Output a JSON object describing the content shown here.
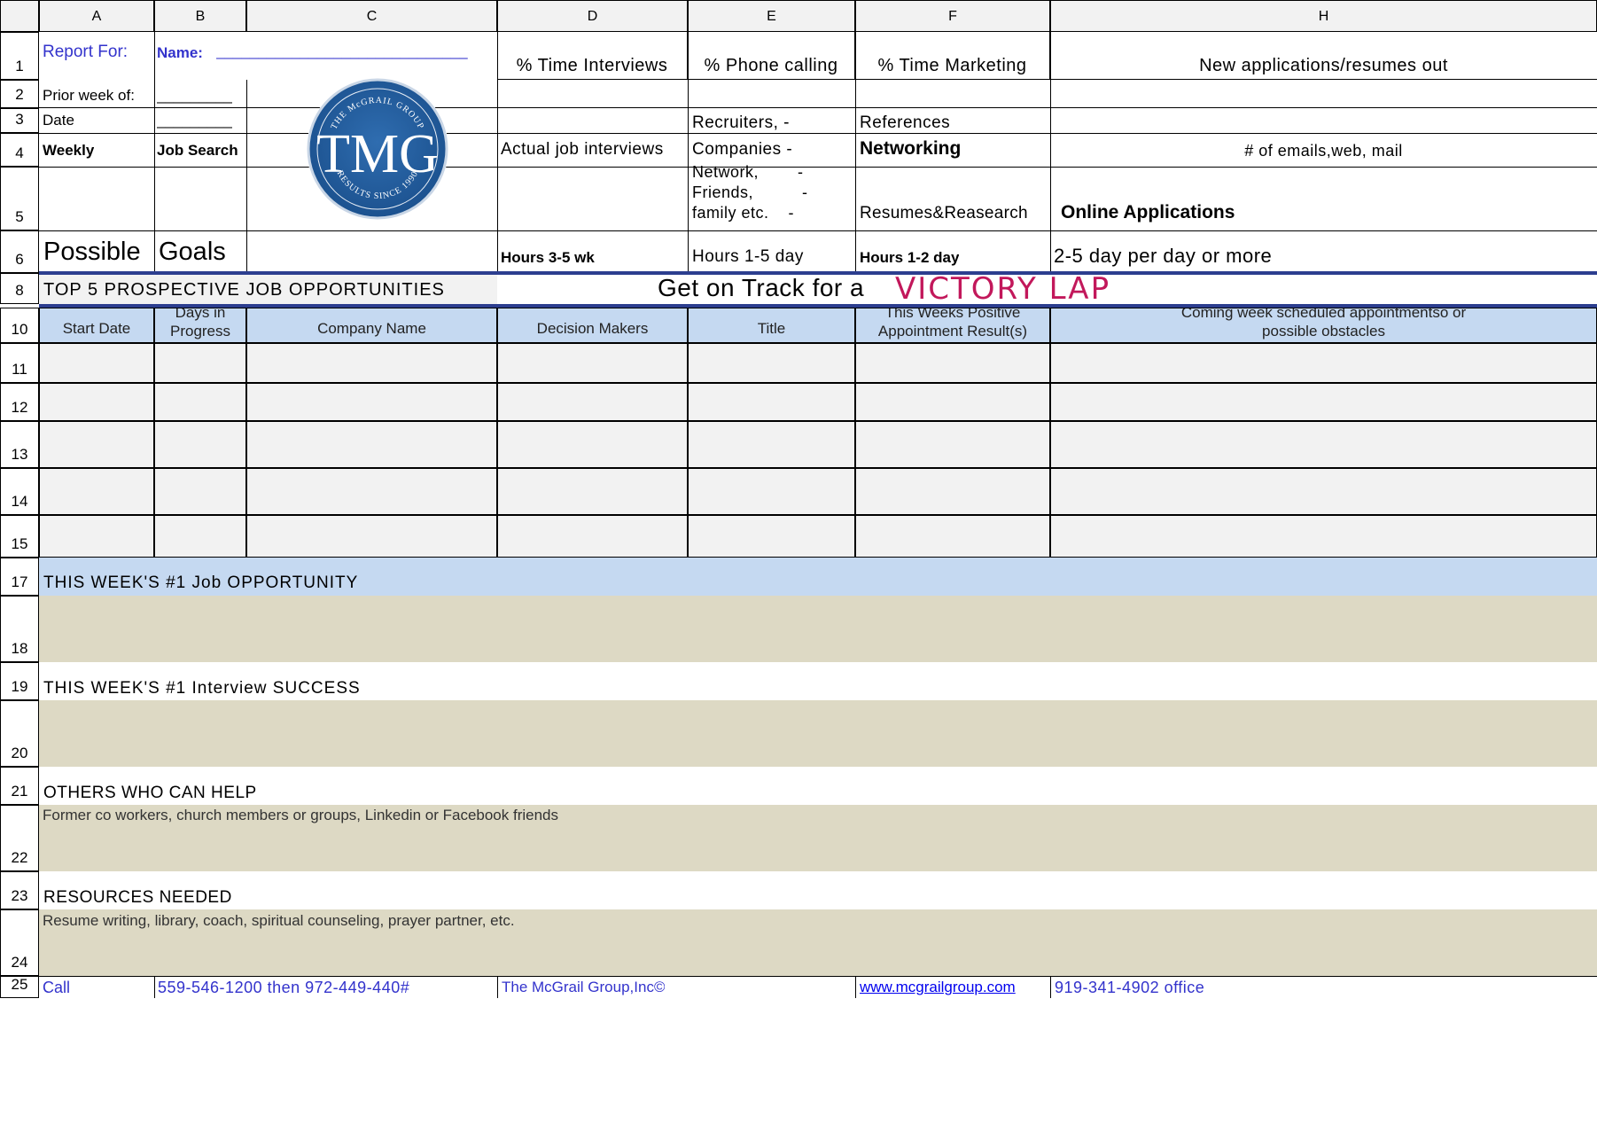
{
  "columns": [
    "A",
    "B",
    "C",
    "D",
    "E",
    "F",
    "H"
  ],
  "row_numbers": [
    "1",
    "2",
    "3",
    "4",
    "5",
    "6",
    "8",
    "10",
    "11",
    "12",
    "13",
    "14",
    "15",
    "17",
    "18",
    "19",
    "20",
    "21",
    "22",
    "23",
    "24",
    "25"
  ],
  "header": {
    "report_for": "Report For:",
    "name_label": "Name:",
    "name_line": "______________________________",
    "prior_week": "Prior week of:",
    "prior_week_blank": "_________",
    "date": "Date",
    "date_blank": "_________",
    "weekly": "Weekly",
    "job_search": "Job Search",
    "possible": "Possible",
    "goals": "Goals",
    "d1": "% Time Interviews",
    "e1": "% Phone calling",
    "f1": "% Time Marketing",
    "h1": "New applications/resumes out",
    "e3": "Recruiters, -",
    "f3": "References",
    "d4": "Actual job interviews",
    "e4": "Companies  -",
    "f4": "Networking",
    "h4": "# of emails,web, mail",
    "e5_1": "Network,        -",
    "e5_2": "Friends,          -",
    "e5_3": "family etc.    -",
    "f5": "Resumes&Reasearch",
    "h5": "Online Applications",
    "d6": "Hours  3-5 wk",
    "e6": "Hours 1-5 day",
    "f6": "Hours 1-2  day",
    "h6": "2-5 day per day or more"
  },
  "logo": {
    "text": "TMG",
    "top_arc": "THE McGRAIL GROUP",
    "bottom_arc": "RESULTS SINCE 1990"
  },
  "section8": {
    "title": "TOP 5 PROSPECTIVE JOB OPPORTUNITIES",
    "track": "Get on Track for a",
    "brand": "VICTORY LAP"
  },
  "table_headers": {
    "a": "Start Date",
    "b": "Days in Progress",
    "c": "Company Name",
    "d": "Decision Makers",
    "e": "Title",
    "f": "This Weeks Positive Appointment Result(s)",
    "h": "Coming week scheduled appointmentso or possible obstacles"
  },
  "sections": {
    "s17": "THIS WEEK'S #1 Job OPPORTUNITY",
    "s19": "THIS WEEK'S #1 Interview SUCCESS",
    "s21": "OTHERS WHO CAN HELP",
    "s22": "Former co workers, church members or groups, Linkedin or Facebook friends",
    "s23": "RESOURCES NEEDED",
    "s24": "Resume writing, library, coach, spiritual counseling, prayer partner, etc."
  },
  "footer": {
    "call": "Call",
    "phone": "559-546-1200  then 972-449-440#",
    "company": "The McGrail Group,Inc©",
    "website": "www.mcgrailgroup.com",
    "office": "919-341-4902  office"
  },
  "colors": {
    "header_blue": "#c5d9f1",
    "tan": "#ddd9c4",
    "victory": "#c2185b",
    "text_blue": "#3333cc"
  }
}
